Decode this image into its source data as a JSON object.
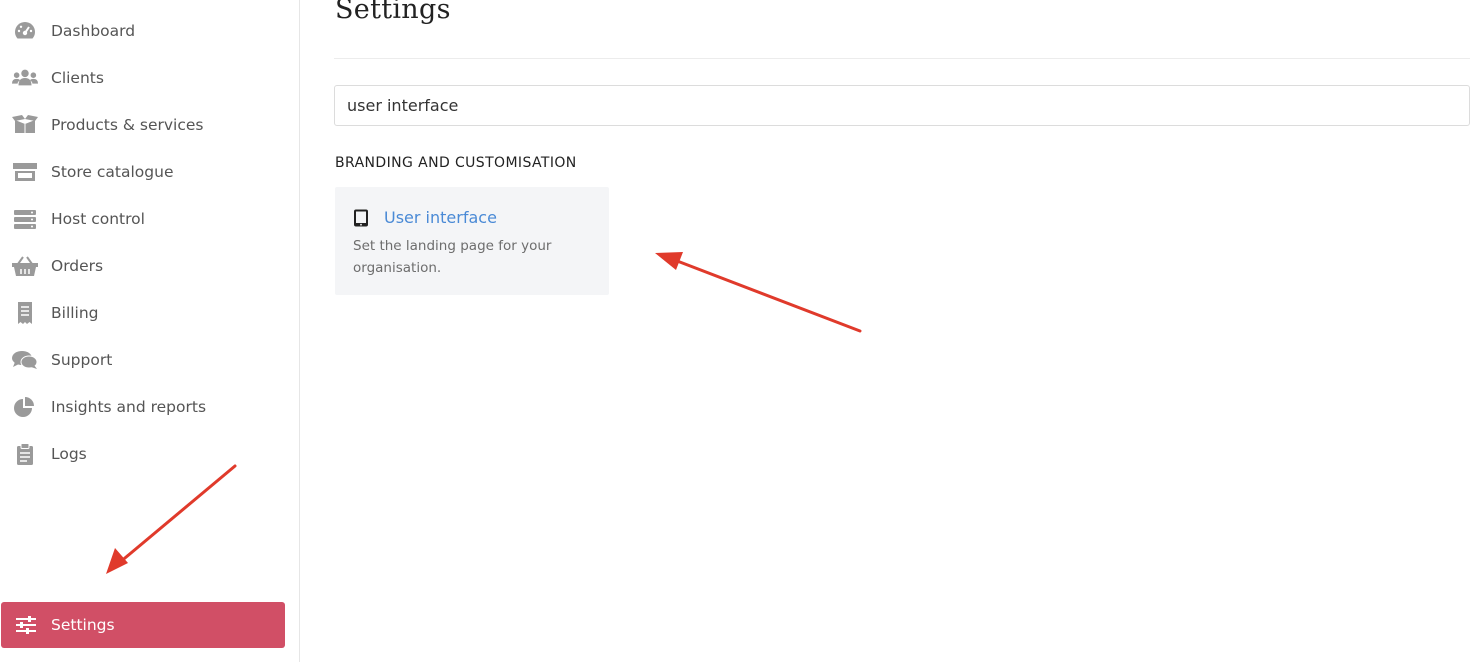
{
  "sidebar": {
    "items": [
      {
        "label": "Dashboard",
        "icon": "dashboard-icon"
      },
      {
        "label": "Clients",
        "icon": "users-icon"
      },
      {
        "label": "Products & services",
        "icon": "box-icon"
      },
      {
        "label": "Store catalogue",
        "icon": "store-icon"
      },
      {
        "label": "Host control",
        "icon": "server-icon"
      },
      {
        "label": "Orders",
        "icon": "basket-icon"
      },
      {
        "label": "Billing",
        "icon": "receipt-icon"
      },
      {
        "label": "Support",
        "icon": "chat-icon"
      },
      {
        "label": "Insights and reports",
        "icon": "pie-chart-icon"
      },
      {
        "label": "Logs",
        "icon": "clipboard-icon"
      }
    ],
    "settings": {
      "label": "Settings",
      "icon": "sliders-icon",
      "active": true
    }
  },
  "main": {
    "title": "Settings",
    "search": {
      "value": "user interface"
    },
    "section": {
      "heading": "BRANDING AND CUSTOMISATION",
      "card": {
        "icon": "tablet-icon",
        "title": "User interface",
        "description": "Set the landing page for your organisation."
      }
    }
  },
  "colors": {
    "active_bg": "#d14f66",
    "link": "#4a8ad6",
    "annotation_arrow": "#e03a2b"
  }
}
